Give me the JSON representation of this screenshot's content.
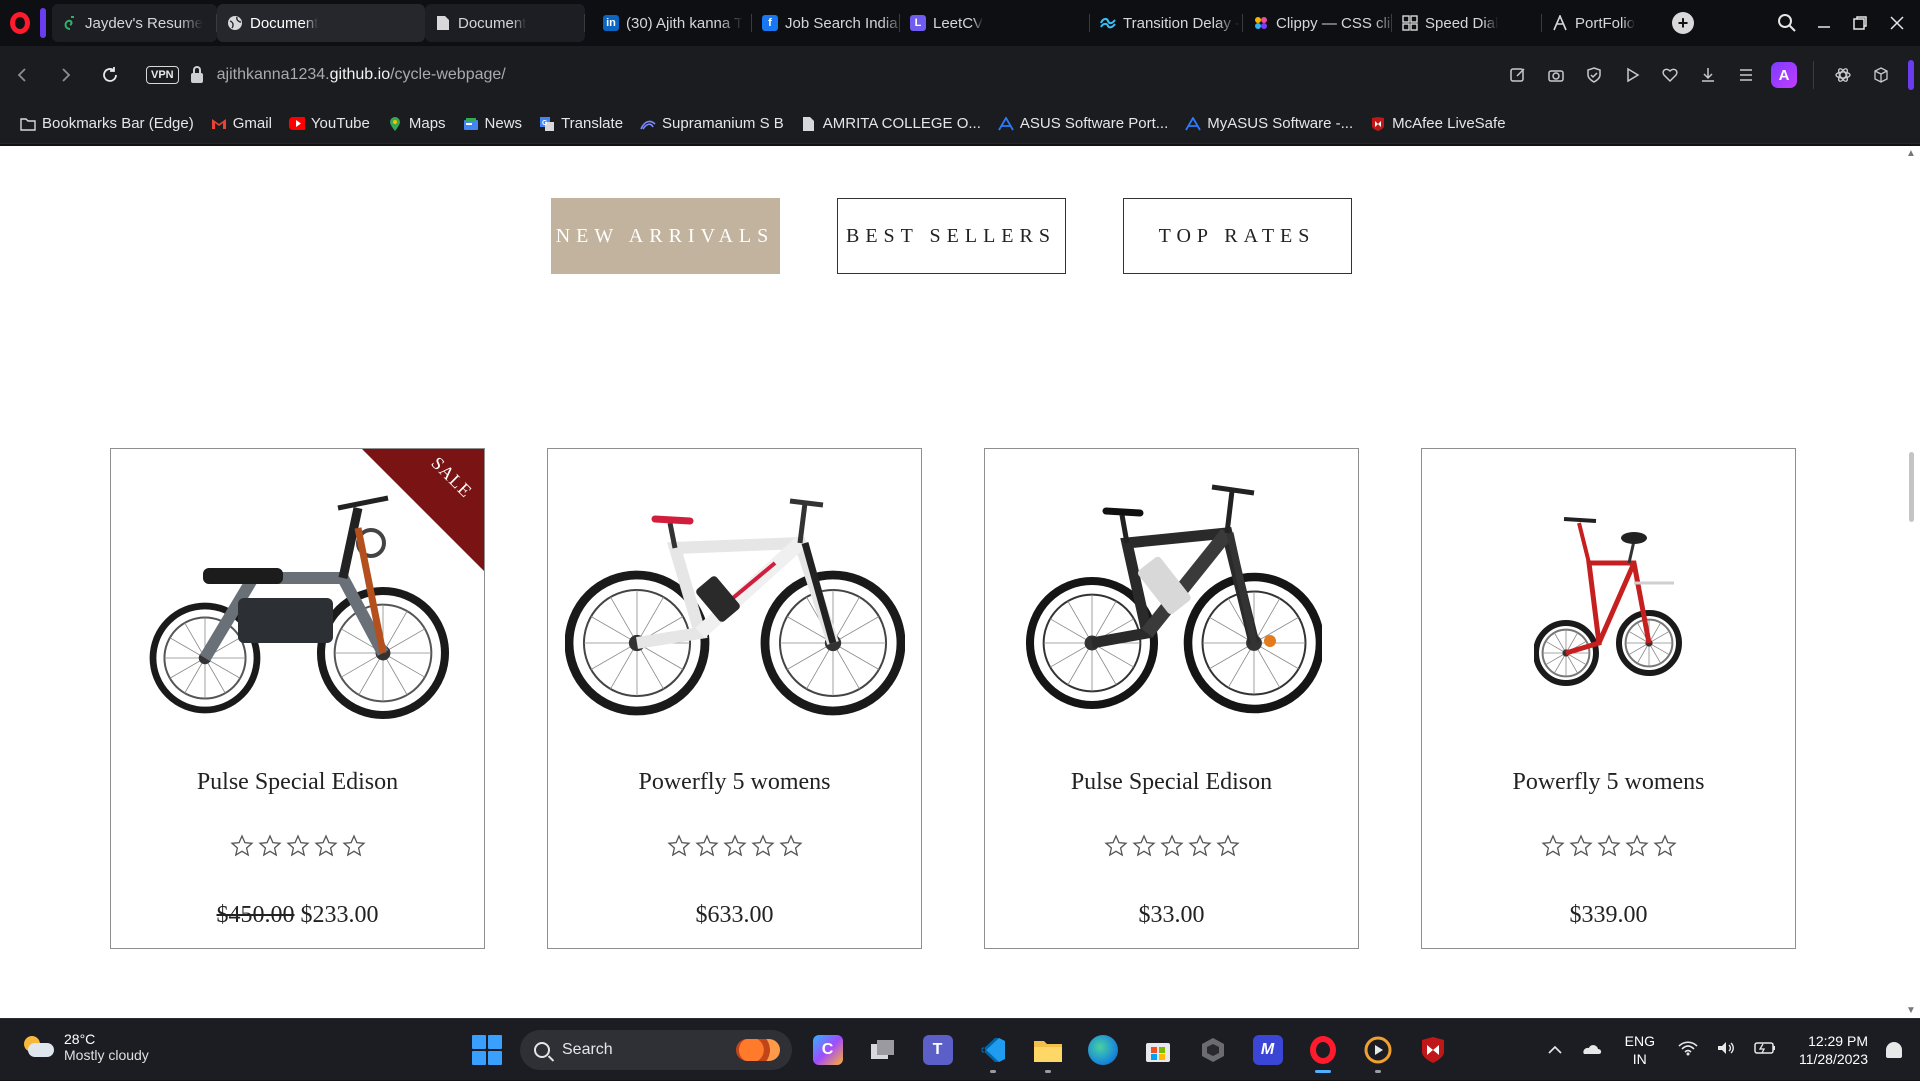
{
  "browser": {
    "tabs": [
      {
        "title": "Jaydev's Resume",
        "icon": "spiral-icon",
        "color": "#2fb36a",
        "state": "normal",
        "grouped": true
      },
      {
        "title": "Document",
        "icon": "globe-icon",
        "color": "#d8d8da",
        "state": "active",
        "grouped": true
      },
      {
        "title": "Document",
        "icon": "document-icon",
        "color": "#d8d8da",
        "state": "normal",
        "grouped": true
      },
      {
        "title": "(30) Ajith kanna T",
        "icon": "linkedin-icon",
        "color": "#0a66c2",
        "state": "normal",
        "grouped": false
      },
      {
        "title": "Job Search India |",
        "icon": "facebook-icon",
        "color": "#1877f2",
        "state": "normal",
        "grouped": false
      },
      {
        "title": "LeetCV",
        "icon": "leetcv-icon",
        "color": "#6f5cf0",
        "state": "normal",
        "grouped": false
      },
      {
        "title": "Transition Delay -",
        "icon": "tailwind-icon",
        "color": "#38bdf8",
        "state": "normal",
        "grouped": false
      },
      {
        "title": "Clippy — CSS clip",
        "icon": "clippy-icon",
        "color": "#e84ea0",
        "state": "normal",
        "grouped": false
      },
      {
        "title": "Speed Dial",
        "icon": "speed-dial-icon",
        "color": "#d8d8da",
        "state": "normal",
        "grouped": false
      },
      {
        "title": "PortFolio",
        "icon": "portfolio-icon",
        "color": "#d8d8da",
        "state": "normal",
        "grouped": false
      }
    ],
    "url_prefix": "ajithkanna1234.",
    "url_domain": "github.io",
    "url_path": "/cycle-webpage/",
    "vpn_label": "VPN",
    "bookmarks": [
      {
        "label": "Bookmarks Bar (Edge)",
        "icon": "folder-icon",
        "color": "#d8d8da"
      },
      {
        "label": "Gmail",
        "icon": "gmail-icon",
        "color": "#ea4335"
      },
      {
        "label": "YouTube",
        "icon": "youtube-icon",
        "color": "#ff0000"
      },
      {
        "label": "Maps",
        "icon": "maps-icon",
        "color": "#34a853"
      },
      {
        "label": "News",
        "icon": "news-icon",
        "color": "#4285f4"
      },
      {
        "label": "Translate",
        "icon": "translate-icon",
        "color": "#4285f4"
      },
      {
        "label": "Supramanium S B",
        "icon": "link-icon",
        "color": "#7b8cff"
      },
      {
        "label": "AMRITA COLLEGE O...",
        "icon": "document-icon",
        "color": "#d8d8da"
      },
      {
        "label": "ASUS Software Port...",
        "icon": "asus-icon",
        "color": "#2a7bff"
      },
      {
        "label": "MyASUS Software -...",
        "icon": "asus-icon",
        "color": "#2a7bff"
      },
      {
        "label": "McAfee LiveSafe",
        "icon": "mcafee-icon",
        "color": "#c01818"
      }
    ]
  },
  "page": {
    "product_tabs": [
      {
        "label": "NEW ARRIVALS",
        "active": true
      },
      {
        "label": "BEST SELLERS",
        "active": false
      },
      {
        "label": "TOP RATES",
        "active": false
      }
    ],
    "sale_label": "SALE",
    "accent_color": "#c1b39e",
    "sale_color": "#7a1414",
    "products": [
      {
        "name": "Pulse Special Edison",
        "old_price": "$450.00",
        "price": "$233.00",
        "rating": 0,
        "max_rating": 5,
        "sale": true,
        "image": "electric-moped-image"
      },
      {
        "name": "Powerfly 5 womens",
        "old_price": "",
        "price": "$633.00",
        "rating": 0,
        "max_rating": 5,
        "sale": false,
        "image": "white-ebike-image"
      },
      {
        "name": "Pulse Special Edison",
        "old_price": "",
        "price": "$33.00",
        "rating": 0,
        "max_rating": 5,
        "sale": false,
        "image": "black-mountain-bike-image"
      },
      {
        "name": "Powerfly 5 womens",
        "old_price": "",
        "price": "$339.00",
        "rating": 0,
        "max_rating": 5,
        "sale": false,
        "image": "red-folding-bike-image"
      }
    ]
  },
  "taskbar": {
    "weather_temp": "28°C",
    "weather_desc": "Mostly cloudy",
    "search_label": "Search",
    "lang_1": "ENG",
    "lang_2": "IN",
    "time": "12:29 PM",
    "date": "11/28/2023"
  }
}
